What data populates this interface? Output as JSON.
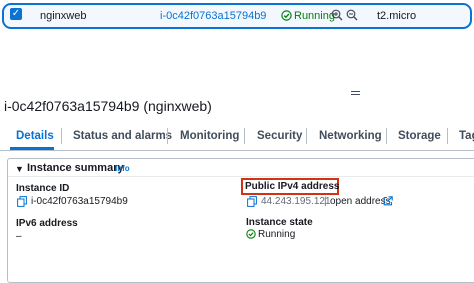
{
  "instance_row": {
    "name": "nginxweb",
    "instance_id": "i-0c42f0763a15794b9",
    "state": "Running",
    "instance_type": "t2.micro"
  },
  "detail": {
    "title": "i-0c42f0763a15794b9 (nginxweb)",
    "tabs": [
      "Details",
      "Status and alarms",
      "Monitoring",
      "Security",
      "Networking",
      "Storage",
      "Tag"
    ],
    "active_tab": "Details"
  },
  "summary": {
    "heading": "Instance summary",
    "info_link": "Info",
    "instance_id_label": "Instance ID",
    "instance_id_value": "i-0c42f0763a15794b9",
    "ipv6_label": "IPv6 address",
    "ipv6_value": "–",
    "public_ipv4_label": "Public IPv4 address",
    "public_ipv4_value": "44.243.195.121",
    "open_address_separator": "|",
    "open_address": "open address",
    "instance_state_label": "Instance state",
    "instance_state_value": "Running"
  },
  "colors": {
    "accent": "#0972d3",
    "success": "#037f0c",
    "highlight": "#d13212"
  },
  "icons": [
    "checkbox-checked-icon",
    "status-running-icon",
    "zoom-in-icon",
    "zoom-out-icon",
    "drag-handle-icon",
    "expand-caret-icon",
    "copy-icon",
    "external-link-icon"
  ]
}
